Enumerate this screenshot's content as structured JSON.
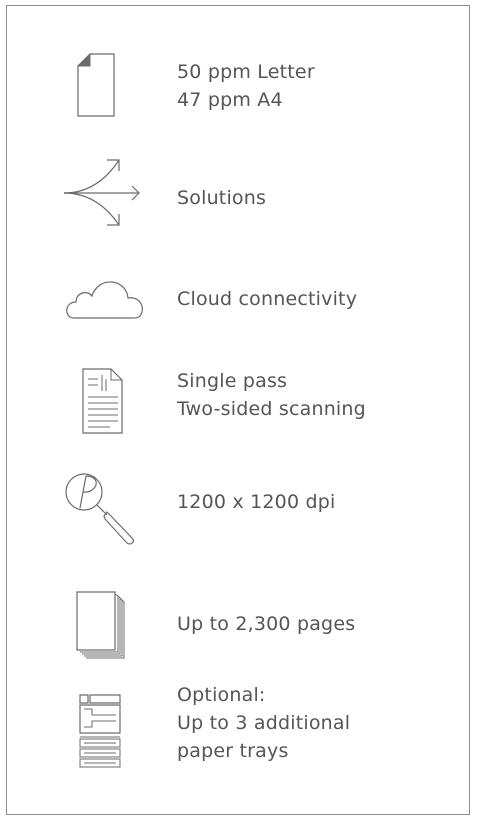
{
  "features": [
    {
      "icon": "page-icon",
      "lines": [
        "50 ppm Letter",
        "47 ppm A4"
      ]
    },
    {
      "icon": "branching-arrows-icon",
      "lines": [
        "Solutions"
      ]
    },
    {
      "icon": "cloud-icon",
      "lines": [
        "Cloud connectivity"
      ]
    },
    {
      "icon": "scanned-document-icon",
      "lines": [
        "Single pass",
        "Two-sided scanning"
      ]
    },
    {
      "icon": "magnifier-icon",
      "lines": [
        "1200 x 1200 dpi"
      ]
    },
    {
      "icon": "paper-stack-icon",
      "lines": [
        "Up to 2,300 pages"
      ]
    },
    {
      "icon": "printer-trays-icon",
      "lines": [
        "Optional:",
        "Up to 3 additional",
        "paper trays"
      ]
    }
  ]
}
